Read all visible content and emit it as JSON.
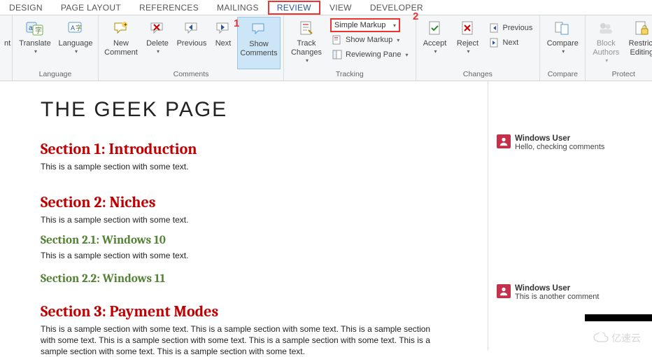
{
  "tabs": {
    "design": "DESIGN",
    "pagelayout": "PAGE LAYOUT",
    "references": "REFERENCES",
    "mailings": "MAILINGS",
    "review": "REVIEW",
    "view": "VIEW",
    "developer": "DEVELOPER"
  },
  "ribbon": {
    "nt": "nt",
    "translate": "Translate",
    "language": "Language",
    "group_language": "Language",
    "new_comment": "New\nComment",
    "delete": "Delete",
    "previous_c": "Previous",
    "next_c": "Next",
    "show_comments": "Show\nComments",
    "group_comments": "Comments",
    "track_changes": "Track\nChanges",
    "simple_markup": "Simple Markup",
    "show_markup": "Show Markup",
    "reviewing_pane": "Reviewing Pane",
    "group_tracking": "Tracking",
    "accept": "Accept",
    "reject": "Reject",
    "previous_ch": "Previous",
    "next_ch": "Next",
    "group_changes": "Changes",
    "compare": "Compare",
    "group_compare": "Compare",
    "block_authors": "Block\nAuthors",
    "restrict_editing": "Restrict\nEditing",
    "group_protect": "Protect"
  },
  "callouts": {
    "one": "1",
    "two": "2"
  },
  "doc": {
    "title": "THE GEEK PAGE",
    "s1_h": "Section 1: Introduction",
    "s1_p": "This is a sample section with some text.",
    "s2_h": "Section 2: Niches",
    "s2_p": "This is a sample section with some text.",
    "s21_h": "Section 2.1: Windows 10",
    "s21_p": "This is a sample section with some text.",
    "s22_h": "Section 2.2: Windows 11",
    "s3_h": "Section 3: Payment Modes",
    "s3_p": "This is a sample section with some text. This is a sample section with some text. This is a sample section with some text. This is a sample section with some text. This is a sample section with some text. This is a sample section with some text. This is a sample section with some text."
  },
  "comments": {
    "c1_author": "Windows User",
    "c1_text": "Hello, checking comments",
    "c2_author": "Windows User",
    "c2_text": "This is another comment"
  },
  "watermark": "亿速云"
}
